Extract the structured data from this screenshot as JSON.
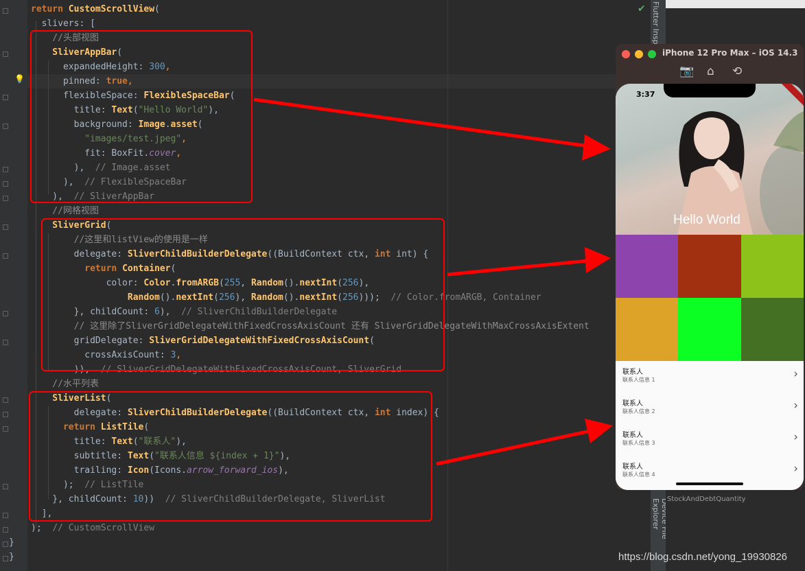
{
  "editor": {
    "lines": [
      {
        "segments": [
          {
            "c": "kw",
            "t": "return "
          },
          {
            "c": "cls",
            "t": "CustomScrollView"
          },
          {
            "c": "prm",
            "t": "("
          }
        ]
      },
      {
        "segments": [
          {
            "c": "prm",
            "t": "  slivers: ["
          }
        ]
      },
      {
        "segments": [
          {
            "c": "cmt",
            "t": "    //头部视图"
          }
        ]
      },
      {
        "segments": [
          {
            "c": "cls",
            "t": "    SliverAppBar"
          },
          {
            "c": "prm",
            "t": "("
          }
        ]
      },
      {
        "segments": [
          {
            "c": "prm",
            "t": "      expandedHeight: "
          },
          {
            "c": "num",
            "t": "300"
          },
          {
            "c": "kw",
            "t": ","
          }
        ]
      },
      {
        "segments": [
          {
            "c": "prm",
            "t": "      pinned: "
          },
          {
            "c": "kw",
            "t": "true,"
          }
        ]
      },
      {
        "segments": [
          {
            "c": "prm",
            "t": "      flexibleSpace: "
          },
          {
            "c": "cls",
            "t": "FlexibleSpaceBar"
          },
          {
            "c": "prm",
            "t": "("
          }
        ]
      },
      {
        "segments": [
          {
            "c": "prm",
            "t": "        title: "
          },
          {
            "c": "cls",
            "t": "Text"
          },
          {
            "c": "prm",
            "t": "("
          },
          {
            "c": "str",
            "t": "\"Hello World\""
          },
          {
            "c": "prm",
            "t": "),"
          }
        ]
      },
      {
        "segments": [
          {
            "c": "prm",
            "t": "        background: "
          },
          {
            "c": "cls",
            "t": "Image"
          },
          {
            "c": "prm",
            "t": "."
          },
          {
            "c": "cls",
            "t": "asset"
          },
          {
            "c": "prm",
            "t": "("
          }
        ]
      },
      {
        "segments": [
          {
            "c": "str",
            "t": "          \"images/test.jpeg\""
          },
          {
            "c": "kw",
            "t": ","
          }
        ]
      },
      {
        "segments": [
          {
            "c": "prm",
            "t": "          fit: BoxFit."
          },
          {
            "c": "it",
            "t": "cover"
          },
          {
            "c": "kw",
            "t": ","
          }
        ]
      },
      {
        "segments": [
          {
            "c": "prm",
            "t": "        ),  "
          },
          {
            "c": "cm",
            "t": "// Image.asset"
          }
        ]
      },
      {
        "segments": [
          {
            "c": "prm",
            "t": "      ),  "
          },
          {
            "c": "cm",
            "t": "// FlexibleSpaceBar"
          }
        ]
      },
      {
        "segments": [
          {
            "c": "prm",
            "t": "    ),  "
          },
          {
            "c": "cm",
            "t": "// SliverAppBar"
          }
        ]
      },
      {
        "segments": [
          {
            "c": "cmt",
            "t": "    //网格视图"
          }
        ]
      },
      {
        "segments": [
          {
            "c": "cls",
            "t": "    SliverGrid"
          },
          {
            "c": "prm",
            "t": "("
          }
        ]
      },
      {
        "segments": [
          {
            "c": "cmt",
            "t": "        //这里和listView的使用是一样"
          }
        ]
      },
      {
        "segments": [
          {
            "c": "prm",
            "t": "        delegate: "
          },
          {
            "c": "cls",
            "t": "SliverChildBuilderDelegate"
          },
          {
            "c": "prm",
            "t": "((BuildContext ctx, "
          },
          {
            "c": "kw",
            "t": "int"
          },
          {
            "c": "prm",
            "t": " int) {"
          }
        ]
      },
      {
        "segments": [
          {
            "c": "kw",
            "t": "          return "
          },
          {
            "c": "cls",
            "t": "Container"
          },
          {
            "c": "prm",
            "t": "("
          }
        ]
      },
      {
        "segments": [
          {
            "c": "prm",
            "t": "              color: "
          },
          {
            "c": "cls",
            "t": "Color"
          },
          {
            "c": "prm",
            "t": "."
          },
          {
            "c": "cls",
            "t": "fromARGB"
          },
          {
            "c": "prm",
            "t": "("
          },
          {
            "c": "num",
            "t": "255"
          },
          {
            "c": "prm",
            "t": ", "
          },
          {
            "c": "cls",
            "t": "Random"
          },
          {
            "c": "prm",
            "t": "()."
          },
          {
            "c": "cls",
            "t": "nextInt"
          },
          {
            "c": "prm",
            "t": "("
          },
          {
            "c": "num",
            "t": "256"
          },
          {
            "c": "prm",
            "t": "),"
          }
        ]
      },
      {
        "segments": [
          {
            "c": "cls",
            "t": "                  Random"
          },
          {
            "c": "prm",
            "t": "()."
          },
          {
            "c": "cls",
            "t": "nextInt"
          },
          {
            "c": "prm",
            "t": "("
          },
          {
            "c": "num",
            "t": "256"
          },
          {
            "c": "prm",
            "t": "), "
          },
          {
            "c": "cls",
            "t": "Random"
          },
          {
            "c": "prm",
            "t": "()."
          },
          {
            "c": "cls",
            "t": "nextInt"
          },
          {
            "c": "prm",
            "t": "("
          },
          {
            "c": "num",
            "t": "256"
          },
          {
            "c": "prm",
            "t": ")));  "
          },
          {
            "c": "cm",
            "t": "// Color.fromARGB, Container"
          }
        ]
      },
      {
        "segments": [
          {
            "c": "prm",
            "t": "        }, childCount: "
          },
          {
            "c": "num",
            "t": "6"
          },
          {
            "c": "prm",
            "t": "),  "
          },
          {
            "c": "cm",
            "t": "// SliverChildBuilderDelegate"
          }
        ]
      },
      {
        "segments": [
          {
            "c": "cmt",
            "t": "        // 这里除了SliverGridDelegateWithFixedCrossAxisCount 还有 SliverGridDelegateWithMaxCrossAxisExtent"
          }
        ]
      },
      {
        "segments": [
          {
            "c": "prm",
            "t": "        gridDelegate: "
          },
          {
            "c": "cls",
            "t": "SliverGridDelegateWithFixedCrossAxisCount"
          },
          {
            "c": "prm",
            "t": "("
          }
        ]
      },
      {
        "segments": [
          {
            "c": "prm",
            "t": "          crossAxisCount: "
          },
          {
            "c": "num",
            "t": "3"
          },
          {
            "c": "kw",
            "t": ","
          }
        ]
      },
      {
        "segments": [
          {
            "c": "prm",
            "t": "        )),  "
          },
          {
            "c": "cm",
            "t": "// SliverGridDelegateWithFixedCrossAxisCount, SliverGrid"
          }
        ]
      },
      {
        "segments": [
          {
            "c": "cmt",
            "t": "    //水平列表"
          }
        ]
      },
      {
        "segments": [
          {
            "c": "cls",
            "t": "    SliverList"
          },
          {
            "c": "prm",
            "t": "("
          }
        ]
      },
      {
        "segments": [
          {
            "c": "prm",
            "t": "        delegate: "
          },
          {
            "c": "cls",
            "t": "SliverChildBuilderDelegate"
          },
          {
            "c": "prm",
            "t": "((BuildContext ctx, "
          },
          {
            "c": "kw",
            "t": "int"
          },
          {
            "c": "prm",
            "t": " index) {"
          }
        ]
      },
      {
        "segments": [
          {
            "c": "kw",
            "t": "      return "
          },
          {
            "c": "cls",
            "t": "ListTile"
          },
          {
            "c": "prm",
            "t": "("
          }
        ]
      },
      {
        "segments": [
          {
            "c": "prm",
            "t": "        title: "
          },
          {
            "c": "cls",
            "t": "Text"
          },
          {
            "c": "prm",
            "t": "("
          },
          {
            "c": "str",
            "t": "\"联系人\""
          },
          {
            "c": "prm",
            "t": "),"
          }
        ]
      },
      {
        "segments": [
          {
            "c": "prm",
            "t": "        subtitle: "
          },
          {
            "c": "cls",
            "t": "Text"
          },
          {
            "c": "prm",
            "t": "("
          },
          {
            "c": "str",
            "t": "\"联系人信息 ${index + 1}\""
          },
          {
            "c": "prm",
            "t": "),"
          }
        ]
      },
      {
        "segments": [
          {
            "c": "prm",
            "t": "        trailing: "
          },
          {
            "c": "cls",
            "t": "Icon"
          },
          {
            "c": "prm",
            "t": "(Icons."
          },
          {
            "c": "it",
            "t": "arrow_forward_ios"
          },
          {
            "c": "prm",
            "t": "),"
          }
        ]
      },
      {
        "segments": [
          {
            "c": "prm",
            "t": "      );  "
          },
          {
            "c": "cm",
            "t": "// ListTile"
          }
        ]
      },
      {
        "segments": [
          {
            "c": "prm",
            "t": "    }, childCount: "
          },
          {
            "c": "num",
            "t": "10"
          },
          {
            "c": "prm",
            "t": "))  "
          },
          {
            "c": "cm",
            "t": "// SliverChildBuilderDelegate, SliverList"
          }
        ]
      },
      {
        "segments": [
          {
            "c": "prm",
            "t": "  ],"
          }
        ]
      },
      {
        "segments": [
          {
            "c": "prm",
            "t": ");  "
          },
          {
            "c": "cm",
            "t": "// CustomScrollView"
          }
        ]
      },
      {
        "segments": [
          {
            "c": "prm",
            "t": "}"
          }
        ]
      },
      {
        "segments": [
          {
            "c": "prm",
            "t": "}"
          }
        ]
      }
    ],
    "line_indents_px": null
  },
  "sidebar": {
    "flutter_inspector": "Flutter Inspector",
    "device_file_explorer": "Device File Explorer"
  },
  "background_snippet": "StockAndDebtQuantity",
  "simulator": {
    "title": "iPhone 12 Pro Max – iOS 14.3",
    "status_time": "3:37",
    "app_bar_title": "Hello World",
    "debug_banner": "DEBUG",
    "grid_colors": [
      "#8e44ad",
      "#a0300f",
      "#8dc21a",
      "#dca328",
      "#0bff22",
      "#447023"
    ],
    "list_items": [
      {
        "title": "联系人",
        "subtitle": "联系人信息 1",
        "trailing_icon": "chevron-right-icon"
      },
      {
        "title": "联系人",
        "subtitle": "联系人信息 2",
        "trailing_icon": "chevron-right-icon"
      },
      {
        "title": "联系人",
        "subtitle": "联系人信息 3",
        "trailing_icon": "chevron-right-icon"
      },
      {
        "title": "联系人",
        "subtitle": "联系人信息 4",
        "trailing_icon": "chevron-right-icon"
      }
    ],
    "toolbar_icons": [
      "camera-icon",
      "home-icon",
      "rotate-icon"
    ]
  },
  "watermark": "https://blog.csdn.net/yong_19930826",
  "colors": {
    "annotation": "#ff0000",
    "editor_bg": "#2b2b2b",
    "keyword": "#cc7832",
    "class": "#ffc66d",
    "string": "#6a8759",
    "number": "#6897bb",
    "comment": "#808080"
  }
}
